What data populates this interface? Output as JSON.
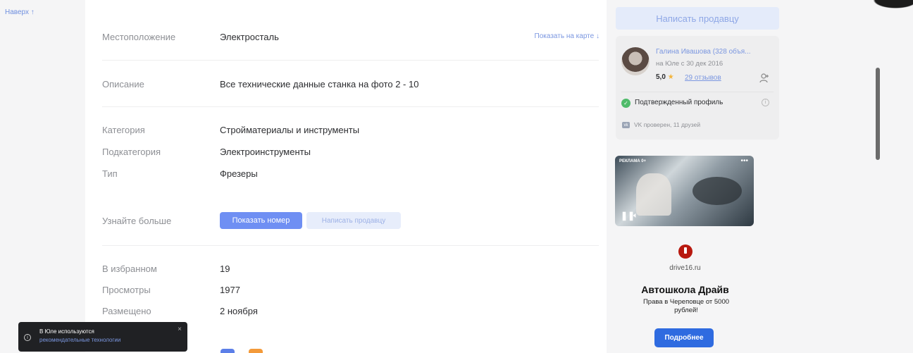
{
  "nav": {
    "to_top": "Наверх ↑"
  },
  "details": {
    "location": {
      "label": "Местоположение",
      "value": "Электросталь",
      "map_link": "Показать на карте ↓"
    },
    "description": {
      "label": "Описание",
      "value": "Все технические данные станка на фото 2 - 10"
    },
    "category": {
      "label": "Категория",
      "value": "Стройматериалы и инструменты"
    },
    "subcategory": {
      "label": "Подкатегория",
      "value": "Электроинструменты"
    },
    "type": {
      "label": "Тип",
      "value": "Фрезеры"
    },
    "learn_more": {
      "label": "Узнайте больше",
      "show_number": "Показать номер",
      "write_seller": "Написать продавцу"
    },
    "favorites": {
      "label": "В избранном",
      "value": "19"
    },
    "views": {
      "label": "Просмотры",
      "value": "1977"
    },
    "posted": {
      "label": "Размещено",
      "value": "2 ноября"
    }
  },
  "sidebar": {
    "write_seller": "Написать продавцу",
    "seller": {
      "name": "Галина Ивашова (328 объя...",
      "since": "на Юле с 30 дек 2016",
      "rating": "5,0",
      "star": "★",
      "reviews": "29 отзывов",
      "verified": "Подтвержденный профиль",
      "vk": "VK проверен, 11 друзей"
    },
    "ad": {
      "video_label": "РЕКЛАМА 0+",
      "domain": "drive16.ru",
      "title": "Автошкола Драйв",
      "text": "Права в Череповце от 5000 рублей!",
      "button": "Подробнее"
    }
  },
  "toast": {
    "line1": "В Юле используются",
    "line2": "рекомендательные технологии",
    "close": "×"
  },
  "colors": {
    "accent": "#6f8ff3",
    "link": "#7b97e0",
    "verified": "#4fbb6a",
    "ad_button": "#2f6be0"
  }
}
